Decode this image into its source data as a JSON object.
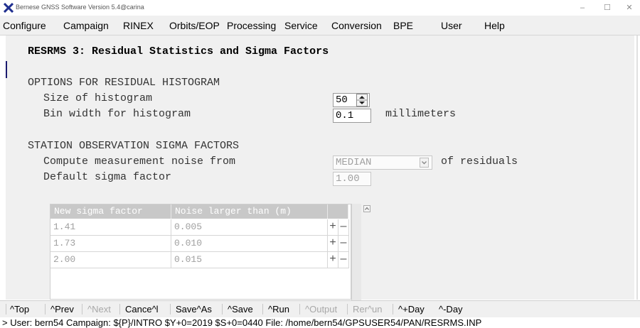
{
  "window": {
    "title": "Bernese GNSS Software Version 5.4@carina",
    "controls": [
      "–",
      "☐",
      "✕"
    ]
  },
  "menu": [
    "Configure",
    "Campaign",
    "RINEX",
    "Orbits/EOP",
    "Processing",
    "Service",
    "Conversion",
    "BPE",
    "User",
    "Help"
  ],
  "panel": {
    "heading": "RESRMS 3: Residual Statistics and Sigma Factors",
    "histogram": {
      "section": "OPTIONS FOR RESIDUAL HISTOGRAM",
      "size_label": "Size of histogram",
      "size_value": "50",
      "bin_label": "Bin width for histogram",
      "bin_value": "0.1",
      "bin_unit": "millimeters"
    },
    "sigma": {
      "section": "STATION OBSERVATION SIGMA FACTORS",
      "noise_label": "Compute measurement noise from",
      "noise_value": "MEDIAN",
      "noise_suffix": "of residuals",
      "default_label": "Default sigma factor",
      "default_value": "1.00"
    },
    "table": {
      "headers": [
        "New sigma factor",
        "Noise larger than (m)"
      ],
      "rows": [
        {
          "factor": "1.41",
          "noise": "0.005"
        },
        {
          "factor": "1.73",
          "noise": "0.010"
        },
        {
          "factor": "2.00",
          "noise": "0.015"
        }
      ],
      "add_symbol": "+",
      "remove_symbol": "–"
    }
  },
  "statusbar": {
    "buttons": [
      {
        "label": "^Top",
        "enabled": true
      },
      {
        "label": "^Prev",
        "enabled": true
      },
      {
        "label": "^Next",
        "enabled": false
      },
      {
        "label": "Cance^l",
        "enabled": true
      },
      {
        "label": "Save^As",
        "enabled": true
      },
      {
        "label": "^Save",
        "enabled": true
      },
      {
        "label": "^Run",
        "enabled": true
      },
      {
        "label": "^Output",
        "enabled": false
      },
      {
        "label": "Rer^un",
        "enabled": false
      },
      {
        "label": "^+Day",
        "enabled": true
      },
      {
        "label": "^-Day",
        "enabled": true
      }
    ],
    "info": "> User: bern54  Campaign: ${P}/INTRO  $Y+0=2019  $S+0=0440  File: /home/bern54/GPSUSER54/PAN/RESRMS.INP"
  },
  "icons": {
    "app": "x-logo-icon",
    "spinner": "spin-arrows-icon",
    "dropdown": "chevron-down-icon"
  },
  "colors": {
    "panel_bg": "#f0f0f0",
    "app_icon_blue": "#1f2f8f",
    "header_gray": "#c8c8c8"
  }
}
